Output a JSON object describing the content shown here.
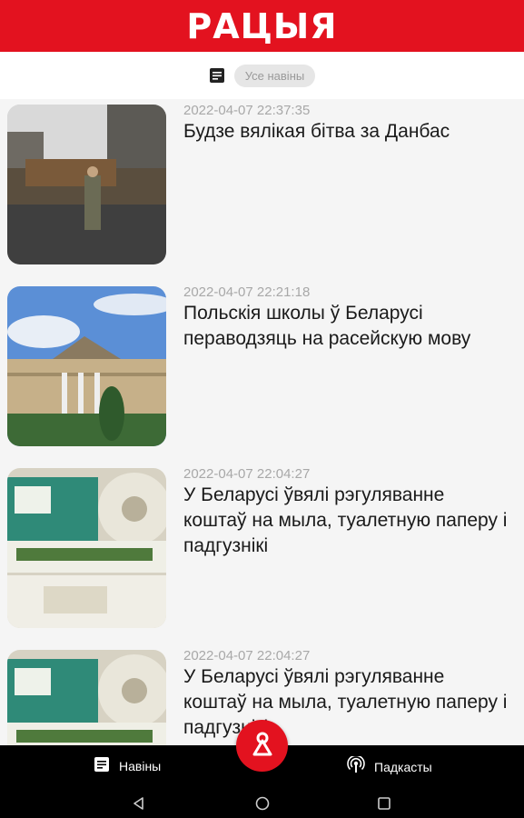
{
  "app": {
    "logo_text": "РАЦЫЯ"
  },
  "filter": {
    "chip_label": "Усе навіны"
  },
  "feed": {
    "items": [
      {
        "timestamp": "2022-04-07 22:37:35",
        "title": "Будзе вялікая бітва за Данбас"
      },
      {
        "timestamp": "2022-04-07 22:21:18",
        "title": "Польскія школы ў Беларусі пераводзяць на расейскую мову"
      },
      {
        "timestamp": "2022-04-07 22:04:27",
        "title": "У Беларусі ўвялі рэгуляванне коштаў на мыла, туалетную паперу і падгузнікі"
      },
      {
        "timestamp": "2022-04-07 22:04:27",
        "title": "У Беларусі ўвялі рэгуляванне коштаў на мыла, туалетную паперу і падгузнікі"
      }
    ]
  },
  "bottom_nav": {
    "news_label": "Навіны",
    "podcasts_label": "Падкасты"
  },
  "icons": [
    "document-icon",
    "radio-logo-icon",
    "podcast-icon",
    "back-icon",
    "home-icon",
    "recents-icon"
  ],
  "colors": {
    "brand": "#e3121f",
    "nav_bg": "#000000",
    "feed_bg": "#f5f5f5"
  }
}
